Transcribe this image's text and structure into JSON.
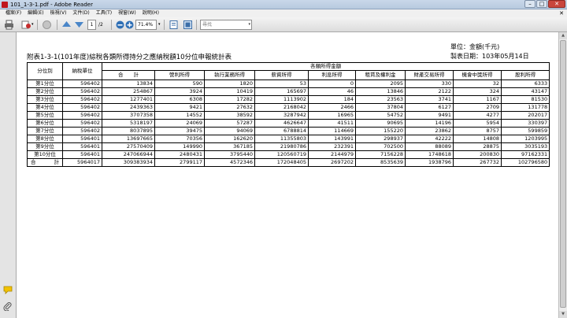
{
  "window": {
    "title": "101_1-3-1.pdf - Adobe Reader",
    "buttons": [
      "–",
      "□",
      "✕"
    ]
  },
  "menu": {
    "items": [
      "檔案(F)",
      "編輯(E)",
      "檢視(V)",
      "文件(D)",
      "工具(T)",
      "視窗(W)",
      "說明(H)"
    ],
    "close": "✕"
  },
  "toolbar": {
    "page_current": "1",
    "page_total": "/2",
    "zoom": "71.4%",
    "search_placeholder": "尋找",
    "colors": {
      "nav_arrow": "#4a86c8",
      "zoom_btn": "#2f6fb5"
    }
  },
  "left_panel": {
    "icons": [
      "comment-icon",
      "attachment-icon"
    ]
  },
  "document": {
    "unit": "單位：金額(千元)",
    "date": "製表日期：103年05月14日",
    "title": "附表1-3-1(101年度)綜稅各類所得持分之應納稅額10分位申報統計表",
    "table": {
      "col_group": "分位別",
      "col_taxpayers": "納稅單位",
      "group_header": "各類所得金額",
      "sub_headers": [
        "合　　計",
        "營利所得",
        "執行業務所得",
        "薪資所得",
        "利息所得",
        "租賃及權利金",
        "財產交易所得",
        "機會中獎所得",
        "股利所得"
      ],
      "rows": [
        {
          "label": "第1分位",
          "values": [
            "596402",
            "13834",
            "590",
            "1820",
            "53",
            "0",
            "2095",
            "330",
            "32",
            "6333"
          ]
        },
        {
          "label": "第2分位",
          "values": [
            "596402",
            "254867",
            "3924",
            "10419",
            "165697",
            "46",
            "13846",
            "2122",
            "324",
            "43147"
          ]
        },
        {
          "label": "第3分位",
          "values": [
            "596402",
            "1277401",
            "6308",
            "17282",
            "1113902",
            "184",
            "23563",
            "3741",
            "1167",
            "81530"
          ]
        },
        {
          "label": "第4分位",
          "values": [
            "596402",
            "2439363",
            "9421",
            "27632",
            "2168042",
            "2466",
            "37804",
            "6127",
            "2709",
            "131778"
          ]
        },
        {
          "label": "第5分位",
          "values": [
            "596402",
            "3707358",
            "14552",
            "38592",
            "3287942",
            "16965",
            "54752",
            "9491",
            "4277",
            "202017"
          ]
        },
        {
          "label": "第6分位",
          "values": [
            "596402",
            "5318197",
            "24069",
            "57287",
            "4626647",
            "41511",
            "90695",
            "14196",
            "5954",
            "330397"
          ]
        },
        {
          "label": "第7分位",
          "values": [
            "596402",
            "8037895",
            "39475",
            "94069",
            "6788814",
            "114669",
            "155220",
            "23862",
            "8757",
            "599859"
          ]
        },
        {
          "label": "第8分位",
          "values": [
            "596401",
            "13697665",
            "70356",
            "162620",
            "11355803",
            "143991",
            "298937",
            "42222",
            "14808",
            "1203995"
          ]
        },
        {
          "label": "第9分位",
          "values": [
            "596401",
            "27570409",
            "149990",
            "367185",
            "21980786",
            "232391",
            "702500",
            "88089",
            "28875",
            "3035193"
          ]
        },
        {
          "label": "第10分位",
          "values": [
            "596401",
            "247066944",
            "2480431",
            "3795440",
            "120560719",
            "2144979",
            "7156228",
            "1748618",
            "200830",
            "97162331"
          ]
        },
        {
          "label": "合　計",
          "values": [
            "5964017",
            "309383934",
            "2799117",
            "4572346",
            "172048405",
            "2697202",
            "8535639",
            "1938796",
            "267732",
            "102796580"
          ]
        }
      ]
    }
  }
}
